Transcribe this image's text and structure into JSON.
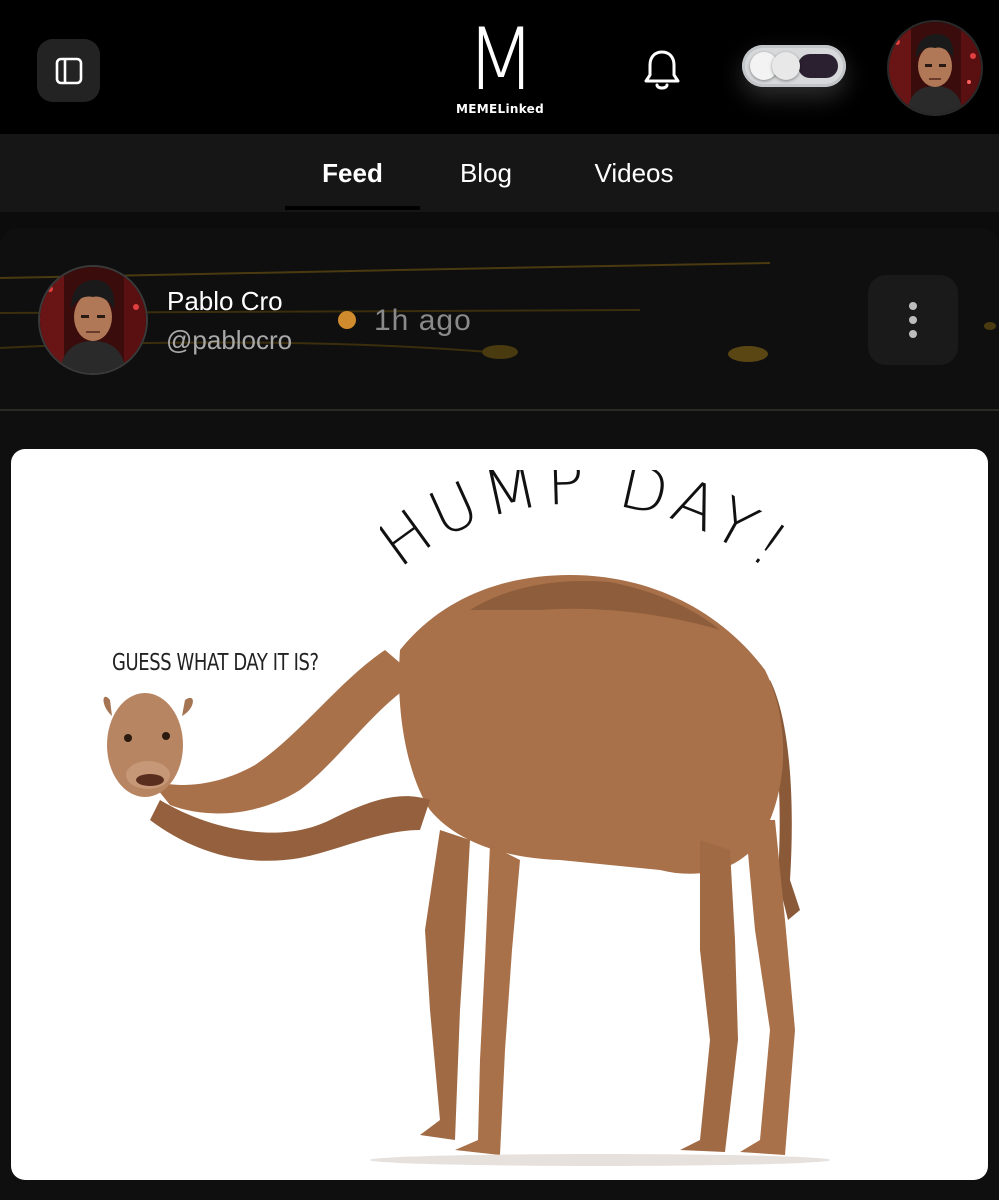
{
  "header": {
    "logo_letter": "M",
    "logo_text": "MEMELinked",
    "icons": {
      "sidebar": "sidebar-toggle-icon",
      "notifications": "bell-icon",
      "theme": "theme-toggle",
      "profile": "avatar"
    }
  },
  "tabs": [
    {
      "label": "Feed",
      "active": true
    },
    {
      "label": "Blog",
      "active": false
    },
    {
      "label": "Videos",
      "active": false
    }
  ],
  "post": {
    "author_name": "Pablo Cro",
    "author_handle": "@pablocro",
    "time": "1h  ago",
    "meme": {
      "title": "HUMP DAY!",
      "speech": "GUESS WHAT DAY IT IS?"
    }
  },
  "colors": {
    "background": "#0c0c0c",
    "header": "#000000",
    "tabbar": "#161616",
    "accent_dot": "#d08b2c",
    "camel": "#a9714a"
  }
}
